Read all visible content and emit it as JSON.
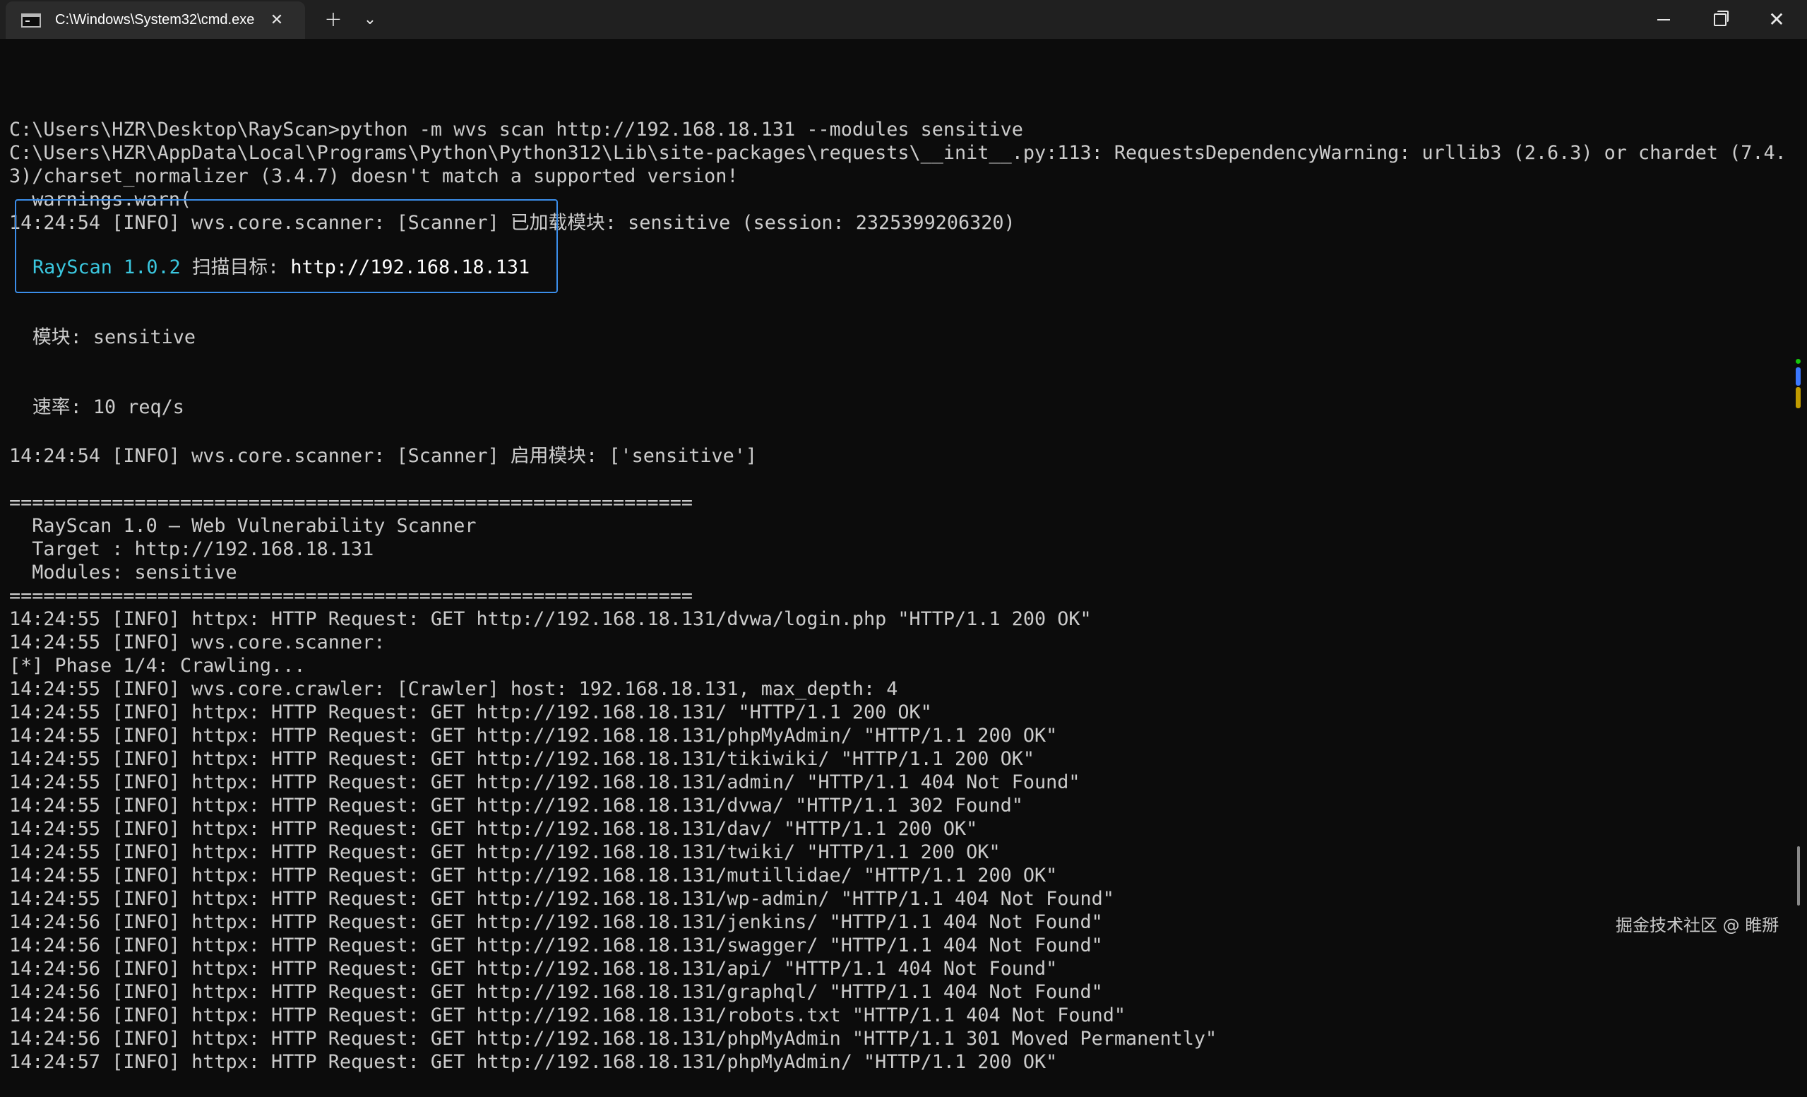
{
  "window": {
    "tab_title": "C:\\Windows\\System32\\cmd.exe",
    "tab_close_icon": "close-icon",
    "new_tab_icon": "plus-icon",
    "dropdown_icon": "chevron-down-icon",
    "controls": [
      "minimize",
      "maximize",
      "close"
    ]
  },
  "console": {
    "lines_before_box": [
      "C:\\Users\\HZR\\Desktop\\RayScan>python -m wvs scan http://192.168.18.131 --modules sensitive",
      "C:\\Users\\HZR\\AppData\\Local\\Programs\\Python\\Python312\\Lib\\site-packages\\requests\\__init__.py:113: RequestsDependencyWarning: urllib3 (2.6.3) or chardet (7.4.",
      "3)/charset_normalizer (3.4.7) doesn't match a supported version!",
      "  warnings.warn(",
      "14:24:54 [INFO] wvs.core.scanner: [Scanner] 已加载模块: sensitive (session: 2325399206320)"
    ],
    "box": {
      "version": "RayScan 1.0.2",
      "target_label": " 扫描目标: ",
      "target_url": "http://192.168.18.131",
      "module_line": "模块: sensitive",
      "rate_line": "速率: 10 req/s"
    },
    "lines_after_box": [
      "14:24:54 [INFO] wvs.core.scanner: [Scanner] 启用模块: ['sensitive']",
      "",
      "============================================================",
      "  RayScan 1.0 — Web Vulnerability Scanner",
      "  Target : http://192.168.18.131",
      "  Modules: sensitive",
      "============================================================",
      "14:24:55 [INFO] httpx: HTTP Request: GET http://192.168.18.131/dvwa/login.php \"HTTP/1.1 200 OK\"",
      "14:24:55 [INFO] wvs.core.scanner:",
      "[*] Phase 1/4: Crawling...",
      "14:24:55 [INFO] wvs.core.crawler: [Crawler] host: 192.168.18.131, max_depth: 4",
      "14:24:55 [INFO] httpx: HTTP Request: GET http://192.168.18.131/ \"HTTP/1.1 200 OK\"",
      "14:24:55 [INFO] httpx: HTTP Request: GET http://192.168.18.131/phpMyAdmin/ \"HTTP/1.1 200 OK\"",
      "14:24:55 [INFO] httpx: HTTP Request: GET http://192.168.18.131/tikiwiki/ \"HTTP/1.1 200 OK\"",
      "14:24:55 [INFO] httpx: HTTP Request: GET http://192.168.18.131/admin/ \"HTTP/1.1 404 Not Found\"",
      "14:24:55 [INFO] httpx: HTTP Request: GET http://192.168.18.131/dvwa/ \"HTTP/1.1 302 Found\"",
      "14:24:55 [INFO] httpx: HTTP Request: GET http://192.168.18.131/dav/ \"HTTP/1.1 200 OK\"",
      "14:24:55 [INFO] httpx: HTTP Request: GET http://192.168.18.131/twiki/ \"HTTP/1.1 200 OK\"",
      "14:24:55 [INFO] httpx: HTTP Request: GET http://192.168.18.131/mutillidae/ \"HTTP/1.1 200 OK\"",
      "14:24:55 [INFO] httpx: HTTP Request: GET http://192.168.18.131/wp-admin/ \"HTTP/1.1 404 Not Found\"",
      "14:24:56 [INFO] httpx: HTTP Request: GET http://192.168.18.131/jenkins/ \"HTTP/1.1 404 Not Found\"",
      "14:24:56 [INFO] httpx: HTTP Request: GET http://192.168.18.131/swagger/ \"HTTP/1.1 404 Not Found\"",
      "14:24:56 [INFO] httpx: HTTP Request: GET http://192.168.18.131/api/ \"HTTP/1.1 404 Not Found\"",
      "14:24:56 [INFO] httpx: HTTP Request: GET http://192.168.18.131/graphql/ \"HTTP/1.1 404 Not Found\"",
      "14:24:56 [INFO] httpx: HTTP Request: GET http://192.168.18.131/robots.txt \"HTTP/1.1 404 Not Found\"",
      "14:24:56 [INFO] httpx: HTTP Request: GET http://192.168.18.131/phpMyAdmin \"HTTP/1.1 301 Moved Permanently\"",
      "14:24:57 [INFO] httpx: HTTP Request: GET http://192.168.18.131/phpMyAdmin/ \"HTTP/1.1 200 OK\""
    ]
  },
  "colors": {
    "background": "#0c0c0c",
    "text": "#cccccc",
    "accent_cyan": "#3bc8e0",
    "box_border": "#3b8eea"
  },
  "watermark": "掘金技术社区 @ 睢掰"
}
